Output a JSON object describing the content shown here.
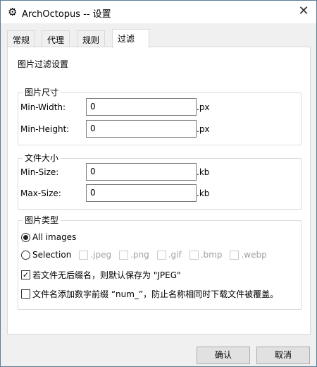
{
  "window": {
    "title": "ArchOctopus -- 设置",
    "icon": "gear-icon"
  },
  "tabs": [
    {
      "label": "常规"
    },
    {
      "label": "代理"
    },
    {
      "label": "规则"
    },
    {
      "label": "过滤",
      "active": true
    }
  ],
  "panel": {
    "heading": "图片过滤设置",
    "size_group": {
      "title": "图片尺寸",
      "min_width_label": "Min-Width:",
      "min_width": "0",
      "min_height_label": "Min-Height:",
      "min_height": "0",
      "unit": ".px"
    },
    "file_group": {
      "title": "文件大小",
      "min_size_label": "Min-Size:",
      "min_size": "0",
      "max_size_label": "Max-Size:",
      "max_size": "0",
      "unit": ".kb"
    },
    "type_group": {
      "title": "图片类型",
      "all_images": "All images",
      "selection": "Selection",
      "selected": "All images",
      "formats": [
        {
          "label": ".jpeg",
          "checked": false
        },
        {
          "label": ".png",
          "checked": false
        },
        {
          "label": ".gif",
          "checked": false
        },
        {
          "label": ".bmp",
          "checked": false
        },
        {
          "label": ".webp",
          "checked": false
        }
      ],
      "default_jpeg": {
        "label": "若文件无后缀名，则默认保存为 \"JPEG\"",
        "checked": true
      },
      "num_prefix": {
        "label": "文件名添加数字前缀 “num_”，防止名称相同时下载文件被覆盖。",
        "checked": false
      }
    }
  },
  "buttons": {
    "ok": "确认",
    "cancel": "取消"
  }
}
